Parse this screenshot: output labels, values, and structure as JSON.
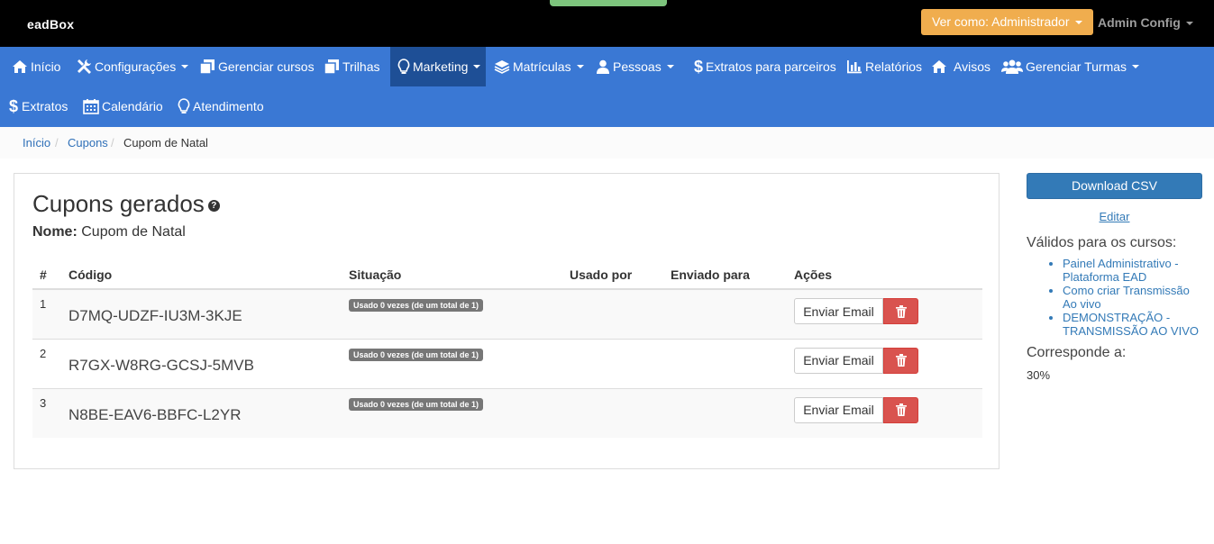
{
  "topbar": {
    "logo": "eadBox",
    "ver_como": "Ver como: Administrador",
    "admin_config": "Admin Config"
  },
  "nav": {
    "inicio": "Início",
    "configuracoes": "Configurações",
    "gerenciar_cursos": "Gerenciar cursos",
    "trilhas": "Trilhas",
    "marketing": "Marketing",
    "matriculas": "Matrículas",
    "pessoas": "Pessoas",
    "extratos_parceiros": "Extratos para parceiros",
    "relatorios": "Relatórios",
    "avisos": "Avisos",
    "gerenciar_turmas": "Gerenciar Turmas",
    "extratos": "Extratos",
    "calendario": "Calendário",
    "atendimento": "Atendimento"
  },
  "breadcrumb": {
    "inicio": "Início",
    "cupons": "Cupons",
    "current": "Cupom de Natal",
    "separator": "/"
  },
  "panel": {
    "title": "Cupons gerados",
    "help_icon": "question-circle-icon",
    "nome_label": "Nome:",
    "nome_value": "Cupom de Natal"
  },
  "table": {
    "headers": {
      "num": "#",
      "codigo": "Código",
      "situacao": "Situação",
      "usado_por": "Usado por",
      "enviado_para": "Enviado para",
      "acoes": "Ações"
    },
    "rows": [
      {
        "num": "1",
        "code": "D7MQ-UDZF-IU3M-3KJE",
        "status": "Usado 0 vezes (de um total de 1)",
        "used_by": "",
        "sent_to": "",
        "email_btn": "Enviar Email"
      },
      {
        "num": "2",
        "code": "R7GX-W8RG-GCSJ-5MVB",
        "status": "Usado 0 vezes (de um total de 1)",
        "used_by": "",
        "sent_to": "",
        "email_btn": "Enviar Email"
      },
      {
        "num": "3",
        "code": "N8BE-EAV6-BBFC-L2YR",
        "status": "Usado 0 vezes (de um total de 1)",
        "used_by": "",
        "sent_to": "",
        "email_btn": "Enviar Email"
      }
    ]
  },
  "sidebar": {
    "download_csv": "Download CSV",
    "editar": "Editar",
    "validos_label": "Válidos para os cursos:",
    "courses": [
      "Painel Administrativo - Plataforma EAD",
      "Como criar Transmissão Ao vivo",
      "DEMONSTRAÇÃO - TRANSMISSÃO AO VIVO"
    ],
    "corresponde_label": "Corresponde a:",
    "corresponde_value": "30%"
  },
  "colors": {
    "navbar": "#3a78d4",
    "navbar_active": "#1e4f96",
    "warning": "#f0ad4e",
    "primary": "#337ab7",
    "danger": "#d9534f"
  }
}
